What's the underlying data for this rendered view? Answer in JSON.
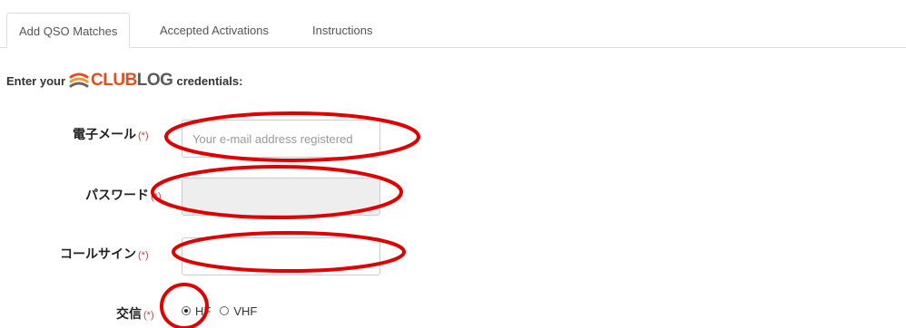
{
  "tabs": [
    {
      "label": "Add QSO Matches",
      "active": true
    },
    {
      "label": "Accepted Activations",
      "active": false
    },
    {
      "label": "Instructions",
      "active": false
    }
  ],
  "credentials": {
    "prefix": "Enter your",
    "logo_club": "CLUB",
    "logo_log": "LOG",
    "suffix": "credentials:"
  },
  "form": {
    "email_label": "電子メール",
    "email_required": "(*)",
    "email_placeholder": "Your e-mail address registered",
    "password_label": "パスワード",
    "password_required": "(*)",
    "callsign_label": "コールサイン",
    "callsign_required": "(*)",
    "band_label": "交信",
    "band_required": "(*)",
    "band_options": [
      {
        "label": "HF",
        "checked": true
      },
      {
        "label": "VHF",
        "checked": false
      }
    ]
  },
  "colors": {
    "annotation": "#e00000",
    "required": "#b94a48",
    "logo_orange": "#e84b1c"
  }
}
